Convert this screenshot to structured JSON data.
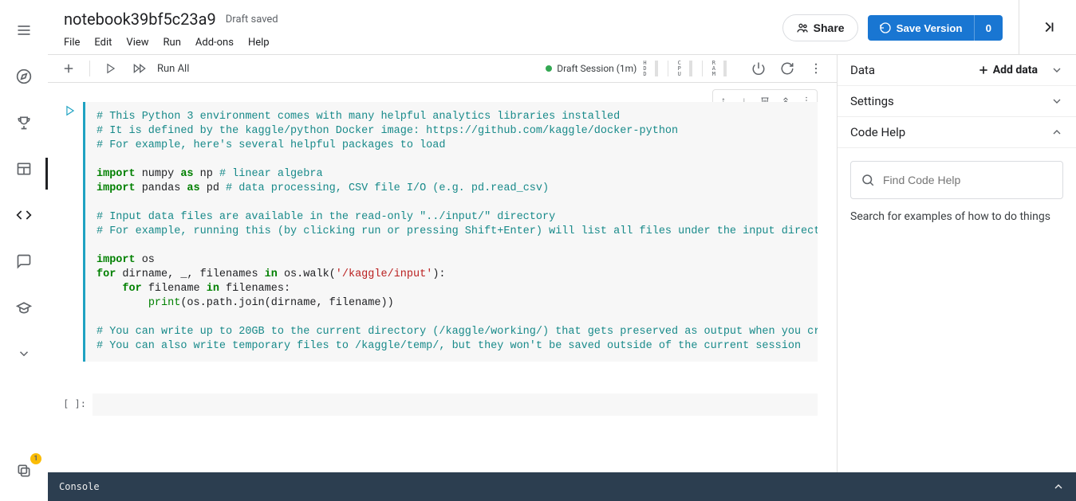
{
  "header": {
    "title": "notebook39bf5c23a9",
    "status": "Draft saved",
    "share_label": "Share",
    "save_label": "Save Version",
    "save_count": "0"
  },
  "menu": {
    "file": "File",
    "edit": "Edit",
    "view": "View",
    "run": "Run",
    "addons": "Add-ons",
    "help": "Help"
  },
  "toolbar": {
    "run_all": "Run All",
    "session": "Draft Session (1m)",
    "hdd": "HDD",
    "cpu": "CPU",
    "ram": "RAM"
  },
  "cell": {
    "code_html": "<span class=\"tok-comment\"># This Python 3 environment comes with many helpful analytics libraries installed</span>\n<span class=\"tok-comment\"># It is defined by the kaggle/python Docker image: https://github.com/kaggle/docker-python</span>\n<span class=\"tok-comment\"># For example, here's several helpful packages to load</span>\n\n<span class=\"tok-kw\">import</span> numpy <span class=\"tok-kw\">as</span> np <span class=\"tok-comment\"># linear algebra</span>\n<span class=\"tok-kw\">import</span> pandas <span class=\"tok-kw\">as</span> pd <span class=\"tok-comment\"># data processing, CSV file I/O (e.g. pd.read_csv)</span>\n\n<span class=\"tok-comment\"># Input data files are available in the read-only \"../input/\" directory</span>\n<span class=\"tok-comment\"># For example, running this (by clicking run or pressing Shift+Enter) will list all files under the input directory</span>\n\n<span class=\"tok-kw\">import</span> os\n<span class=\"tok-kw\">for</span> dirname, _, filenames <span class=\"tok-kw\">in</span> os.walk(<span class=\"tok-str\">'/kaggle/input'</span>):\n    <span class=\"tok-kw\">for</span> filename <span class=\"tok-kw\">in</span> filenames:\n        <span class=\"tok-builtin\">print</span>(os.path.join(dirname, filename))\n\n<span class=\"tok-comment\"># You can write up to 20GB to the current directory (/kaggle/working/) that gets preserved as output when you create a version using \"Save &amp; Run All\"</span>\n<span class=\"tok-comment\"># You can also write temporary files to /kaggle/temp/, but they won't be saved outside of the current session</span>"
  },
  "empty_prompt": "[ ]:",
  "sidebar": {
    "data": "Data",
    "add_data": "Add data",
    "settings": "Settings",
    "code_help": "Code Help",
    "search_placeholder": "Find Code Help",
    "hint": "Search for examples of how to do things"
  },
  "console": {
    "label": "Console"
  },
  "rail_badge": "1"
}
